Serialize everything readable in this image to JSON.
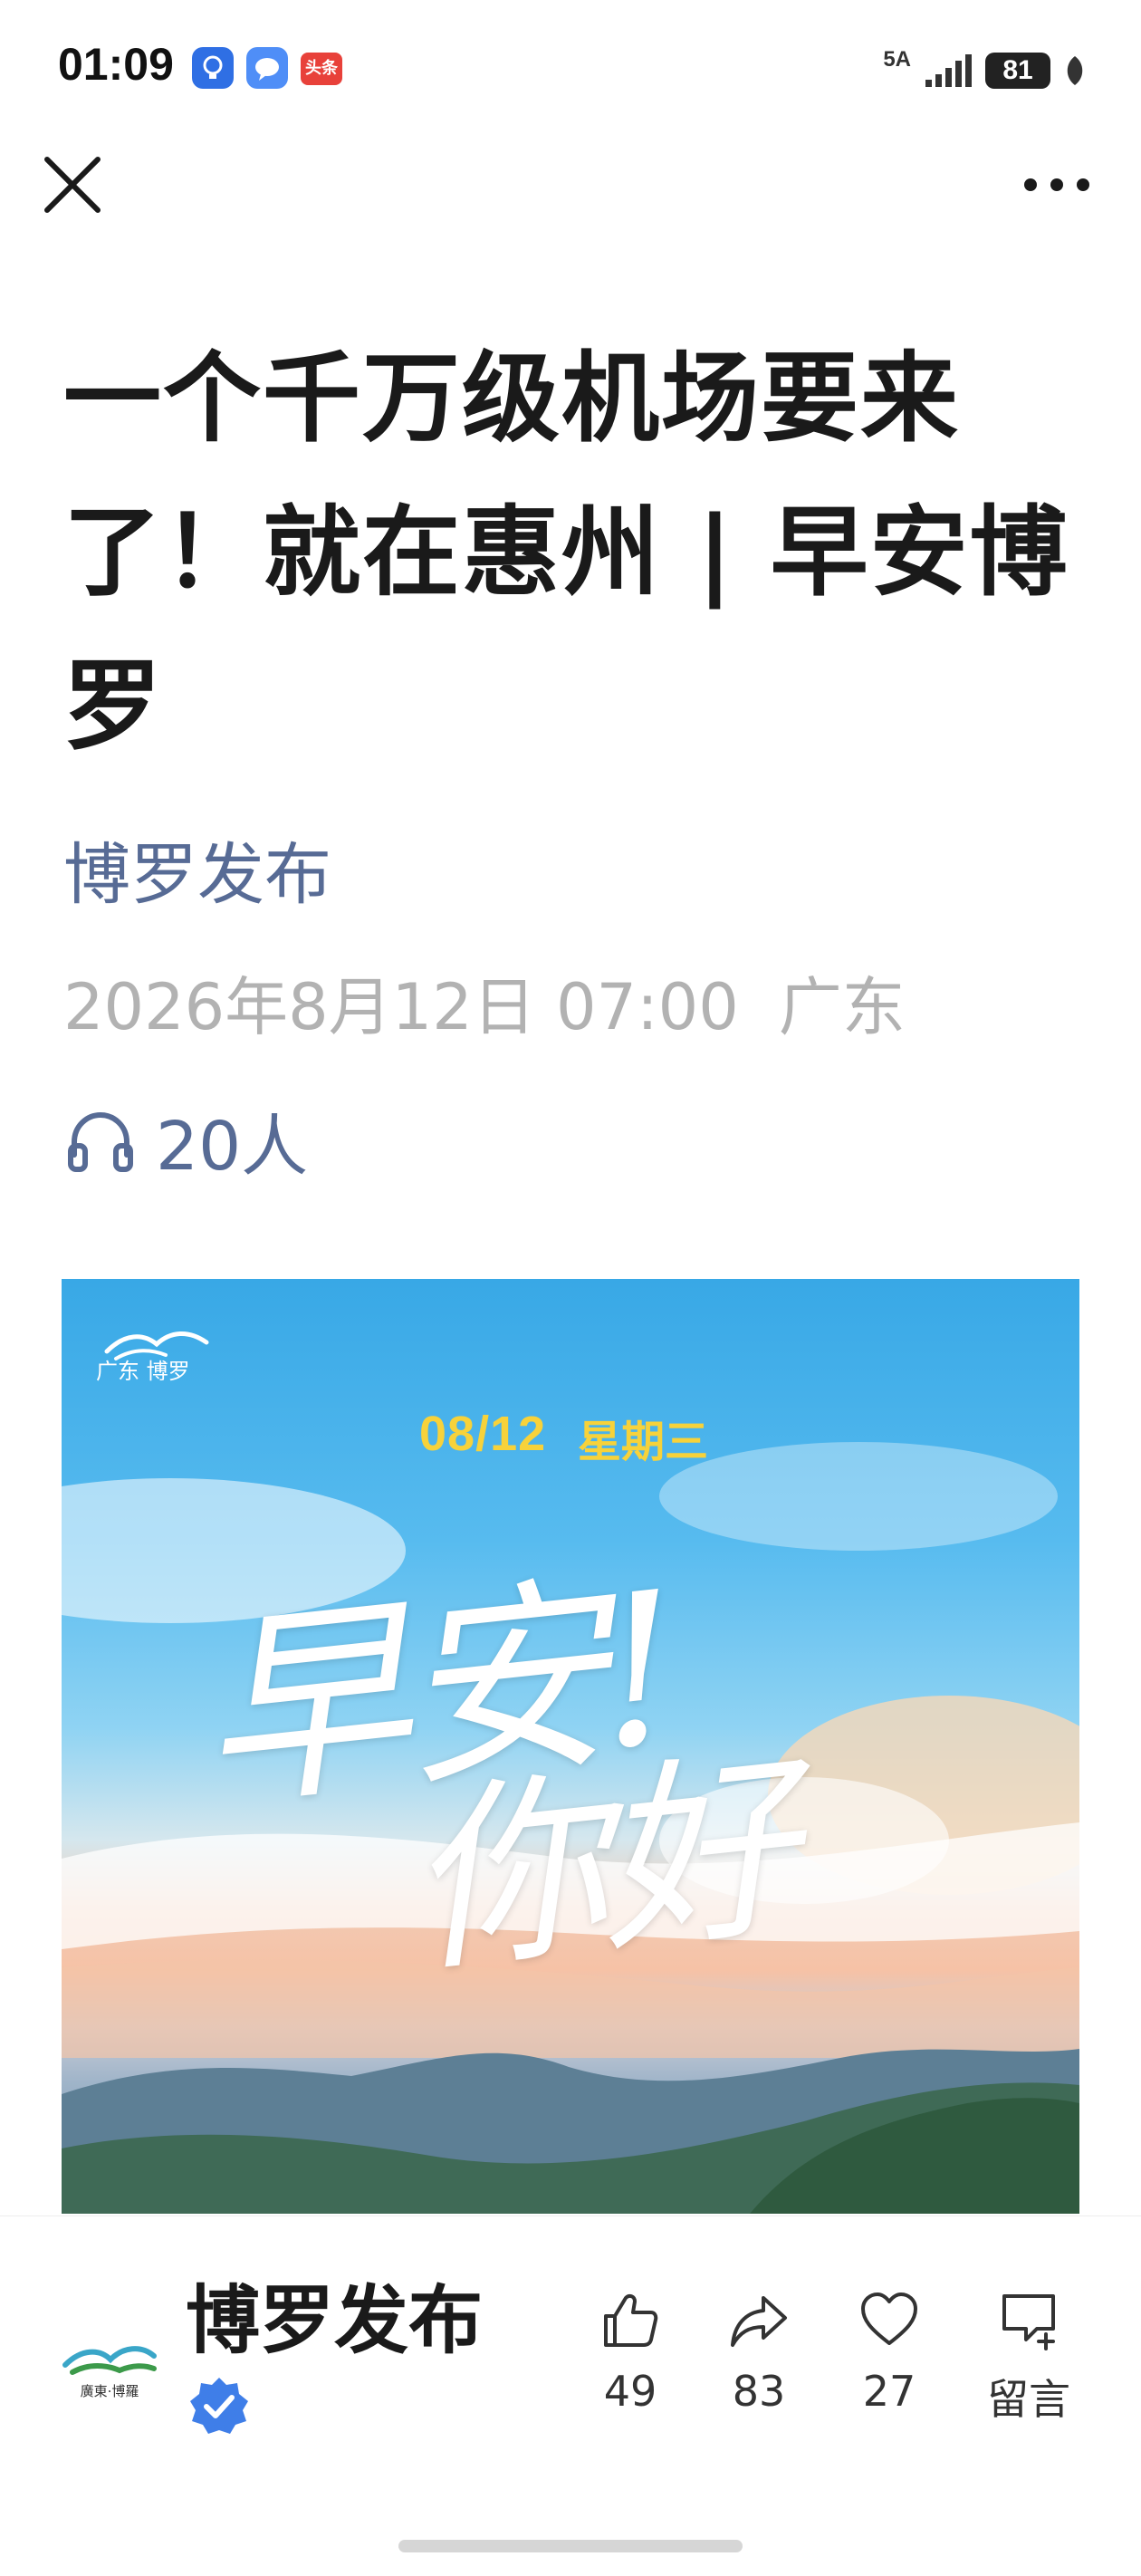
{
  "status_bar": {
    "time": "01:09",
    "app_icons": [
      "lightbulb-app-icon",
      "message-app-icon",
      "toutiao-app-icon"
    ],
    "toutiao_label": "头条",
    "network": "5A",
    "battery": "81",
    "colors": {
      "lightbulb_app": "#2f6fe4",
      "message_app": "#4f8ef7",
      "toutiao_app": "#e8413a"
    }
  },
  "nav": {
    "close_icon": "close-icon",
    "more_icon": "more-icon"
  },
  "article": {
    "title": "一个千万级机场要来了！就在惠州 | 早安博罗",
    "account_name": "博罗发布",
    "date": "2026年8月12日 07:00",
    "location": "广东",
    "listen_icon": "headphones-icon",
    "listeners": "20人",
    "colors": {
      "account_link": "#576b95",
      "meta_gray": "#b2b2b2"
    }
  },
  "cover": {
    "logo_text": "广东 博罗",
    "date": "08/12",
    "weekday": "星期三",
    "greeting_line1": "早安!",
    "greeting_line2": "你好",
    "colors": {
      "date_yellow": "#f7d23a",
      "sky_blue": "#38a8e6"
    }
  },
  "bottom_bar": {
    "account_name": "博罗发布",
    "avatar_text": "廣東·博羅",
    "verified_icon": "verified-badge-icon",
    "actions": [
      {
        "icon": "thumbs-up-icon",
        "label": "49"
      },
      {
        "icon": "share-icon",
        "label": "83"
      },
      {
        "icon": "heart-icon",
        "label": "27"
      },
      {
        "icon": "comment-icon",
        "label": "留言"
      }
    ]
  }
}
